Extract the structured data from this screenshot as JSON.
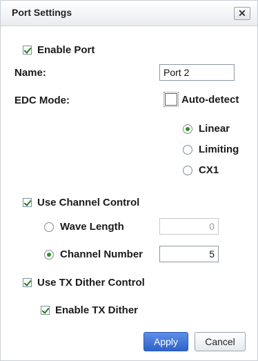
{
  "dialog": {
    "title": "Port Settings",
    "close_glyph": "✕"
  },
  "enable_port": {
    "label": "Enable Port",
    "checked": true
  },
  "name": {
    "label": "Name:",
    "value": "Port 2"
  },
  "edc_mode": {
    "label": "EDC Mode:",
    "auto_detect": {
      "label": "Auto-detect",
      "checked": false
    },
    "options": [
      {
        "label": "Linear",
        "selected": true
      },
      {
        "label": "Limiting",
        "selected": false
      },
      {
        "label": "CX1",
        "selected": false
      }
    ]
  },
  "channel_control": {
    "label": "Use Channel Control",
    "checked": true,
    "wave_length": {
      "label": "Wave Length",
      "selected": false,
      "value": "0"
    },
    "channel_number": {
      "label": "Channel Number",
      "selected": true,
      "value": "5"
    }
  },
  "tx_dither_control": {
    "label": "Use TX Dither Control",
    "checked": true,
    "enable_tx_dither": {
      "label": "Enable TX Dither",
      "checked": true
    }
  },
  "buttons": {
    "apply": "Apply",
    "cancel": "Cancel"
  }
}
